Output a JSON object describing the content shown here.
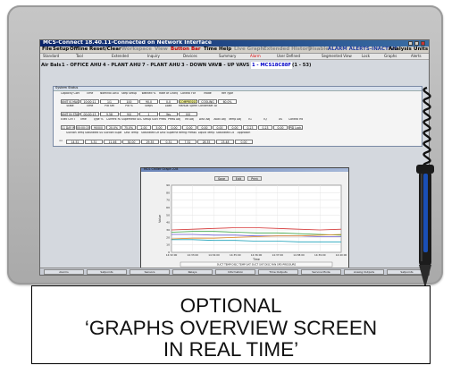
{
  "app": {
    "window_title": "MCS-Connect 18.40.11-Connected on Network Interface"
  },
  "menu": [
    {
      "label": "File"
    },
    {
      "label": "Setup"
    },
    {
      "label": "Offline"
    },
    {
      "label": "Reset/Clear"
    },
    {
      "label": "Workspace"
    },
    {
      "label": "View"
    },
    {
      "label": "Button Bar"
    },
    {
      "label": "Time"
    },
    {
      "label": "Help"
    },
    {
      "label": "Live Graph"
    },
    {
      "label": "Extended History"
    },
    {
      "label": "Disable"
    },
    {
      "label": "ALARM ALERTS-INACTIVE"
    },
    {
      "label": "Analysis"
    },
    {
      "label": "Units"
    }
  ],
  "toolbar": [
    {
      "label": "Standard"
    },
    {
      "label": "Tool"
    },
    {
      "label": "Extended"
    },
    {
      "label": "Inquiry"
    },
    {
      "label": "Devices"
    },
    {
      "label": "Summary"
    },
    {
      "label": "Alarm"
    },
    {
      "label": "User Defined"
    },
    {
      "label": "Segmented View"
    },
    {
      "label": "Lock"
    },
    {
      "label": "Graphs"
    },
    {
      "label": "Alerts"
    }
  ],
  "areas": {
    "prefix": "Air Bals",
    "items": [
      {
        "label": "1 - OFFICE AHU"
      },
      {
        "label": "4 - PLANT AHU"
      },
      {
        "label": "7 - PLANT AHU"
      },
      {
        "label": "3 - DOWN VAVS"
      },
      {
        "label": "4 - UP VAVS"
      },
      {
        "label": "1 - MCS18C88F"
      },
      {
        "label": "(1 - 53)"
      }
    ]
  },
  "status_panel": {
    "title": "System Status",
    "row1_headers": [
      "Capacity Control Mode",
      "Time",
      "Nominal Actual",
      "Step Setup",
      "Wanted %",
      "Rate of Change",
      "Control For",
      "Mode",
      "Ref Type"
    ],
    "row1_values": [
      "UNIT IS MASTER",
      "10:00:11",
      "1/1",
      "100",
      "90.0",
      "0.0",
      "COMPRESSOR STAGE",
      "COOLING",
      "60.0%"
    ],
    "row2_headers": [
      "State",
      "Time",
      "Pid Set",
      "Pid %",
      "Steps",
      "Load",
      "Manual Speed %",
      "Condenser Adjustment"
    ],
    "row2_values": [
      "UNIT IN STARTUP",
      "00:00:13",
      "9.58",
      "9/0",
      "1",
      "Yes",
      "0/0"
    ],
    "row3_headers": [
      "Exec Ctrl Time",
      "Time",
      "Type %",
      "Current Run/Capt",
      "Superheat SEC",
      "SEC Setup",
      "Suct Press Setpoint",
      "Press Adj",
      "Int Adj",
      "Disc Adj",
      "Avail Adj",
      "Temp Adj",
      "IG",
      "IQ",
      "XS",
      "Control Mode"
    ],
    "row3_values": [
      "11 DAY IN STARTUP",
      "00:00:15",
      "90/0/0",
      "20.0%",
      "75.0%",
      "2.00",
      "5.00",
      "0.00",
      "0.00",
      "0.00",
      "0.00",
      "0.00",
      "0.23",
      "0.23",
      "0.00",
      "PID Lock...00"
    ],
    "row4_headers": [
      "Suction Temp",
      "Saturated Suction",
      "Suction Superheat",
      "Disc Temp",
      "Saturated Discharge",
      "Disc Superheat",
      "Refrig Pressure",
      "Liquid Temp",
      "Saturated Liquid Temp",
      "Approach"
    ],
    "row4_values": [
      "14.52",
      "3.31",
      "11.46",
      "30.00",
      "29.35",
      "0.31",
      "7.52",
      "28.35",
      "23.48",
      "0.00"
    ],
    "row4_index": "11"
  },
  "graph_window": {
    "title": "MCS Chiller Graph 228",
    "buttons": [
      {
        "label": "Save"
      },
      {
        "label": "Edit"
      },
      {
        "label": "Print"
      }
    ],
    "xlabel": "Time",
    "ylabel": "Value",
    "legend": "SUCT TEMP  DISC TEMP  SAT SUCT  SAT DISC  FAN SPD  PRESSURE"
  },
  "chart_data": {
    "type": "line",
    "ylabel": "Value",
    "xlabel": "Time",
    "ylim": [
      0,
      90
    ],
    "yticks": [
      0,
      10,
      20,
      30,
      40,
      50,
      60,
      70,
      80,
      90
    ],
    "x": [
      "14:32:00",
      "14:33:00",
      "14:34:00",
      "14:35:00",
      "14:36:00",
      "14:37:00",
      "14:38:00",
      "14:39:00",
      "14:40:00"
    ],
    "grid": true,
    "series": [
      {
        "color": "#d63a3a",
        "values": [
          30,
          31,
          32,
          33,
          33,
          32,
          31,
          30,
          31
        ]
      },
      {
        "color": "#3fa548",
        "values": [
          27,
          28,
          28,
          27,
          26,
          26,
          25,
          24,
          23
        ]
      },
      {
        "color": "#6a5acd",
        "values": [
          24,
          24,
          23,
          23,
          22,
          22,
          22,
          21,
          21
        ]
      },
      {
        "color": "#e08a2a",
        "values": [
          18,
          19,
          19,
          20,
          21,
          22,
          22,
          23,
          24
        ]
      },
      {
        "color": "#1aa0b8",
        "values": [
          17,
          17,
          16,
          16,
          15,
          15,
          14,
          14,
          14
        ]
      }
    ]
  },
  "taskbar": [
    {
      "label": "Alarms"
    },
    {
      "label": "Setpoints"
    },
    {
      "label": "Sensors"
    },
    {
      "label": "Relays"
    },
    {
      "label": "Information"
    },
    {
      "label": "Time Outputs"
    },
    {
      "label": "Service Mode"
    },
    {
      "label": "Analog Outputs"
    },
    {
      "label": "Setpoints"
    }
  ],
  "caption": {
    "line1": "OPTIONAL",
    "line2": "‘GRAPHS OVERVIEW SCREEN",
    "line3": "IN REAL TIME’"
  },
  "colors": {
    "titlebar": "#0a246a",
    "menu_red": "#c00000",
    "menu_blue": "#1a37a0",
    "status_yellow": "#ffff99"
  }
}
